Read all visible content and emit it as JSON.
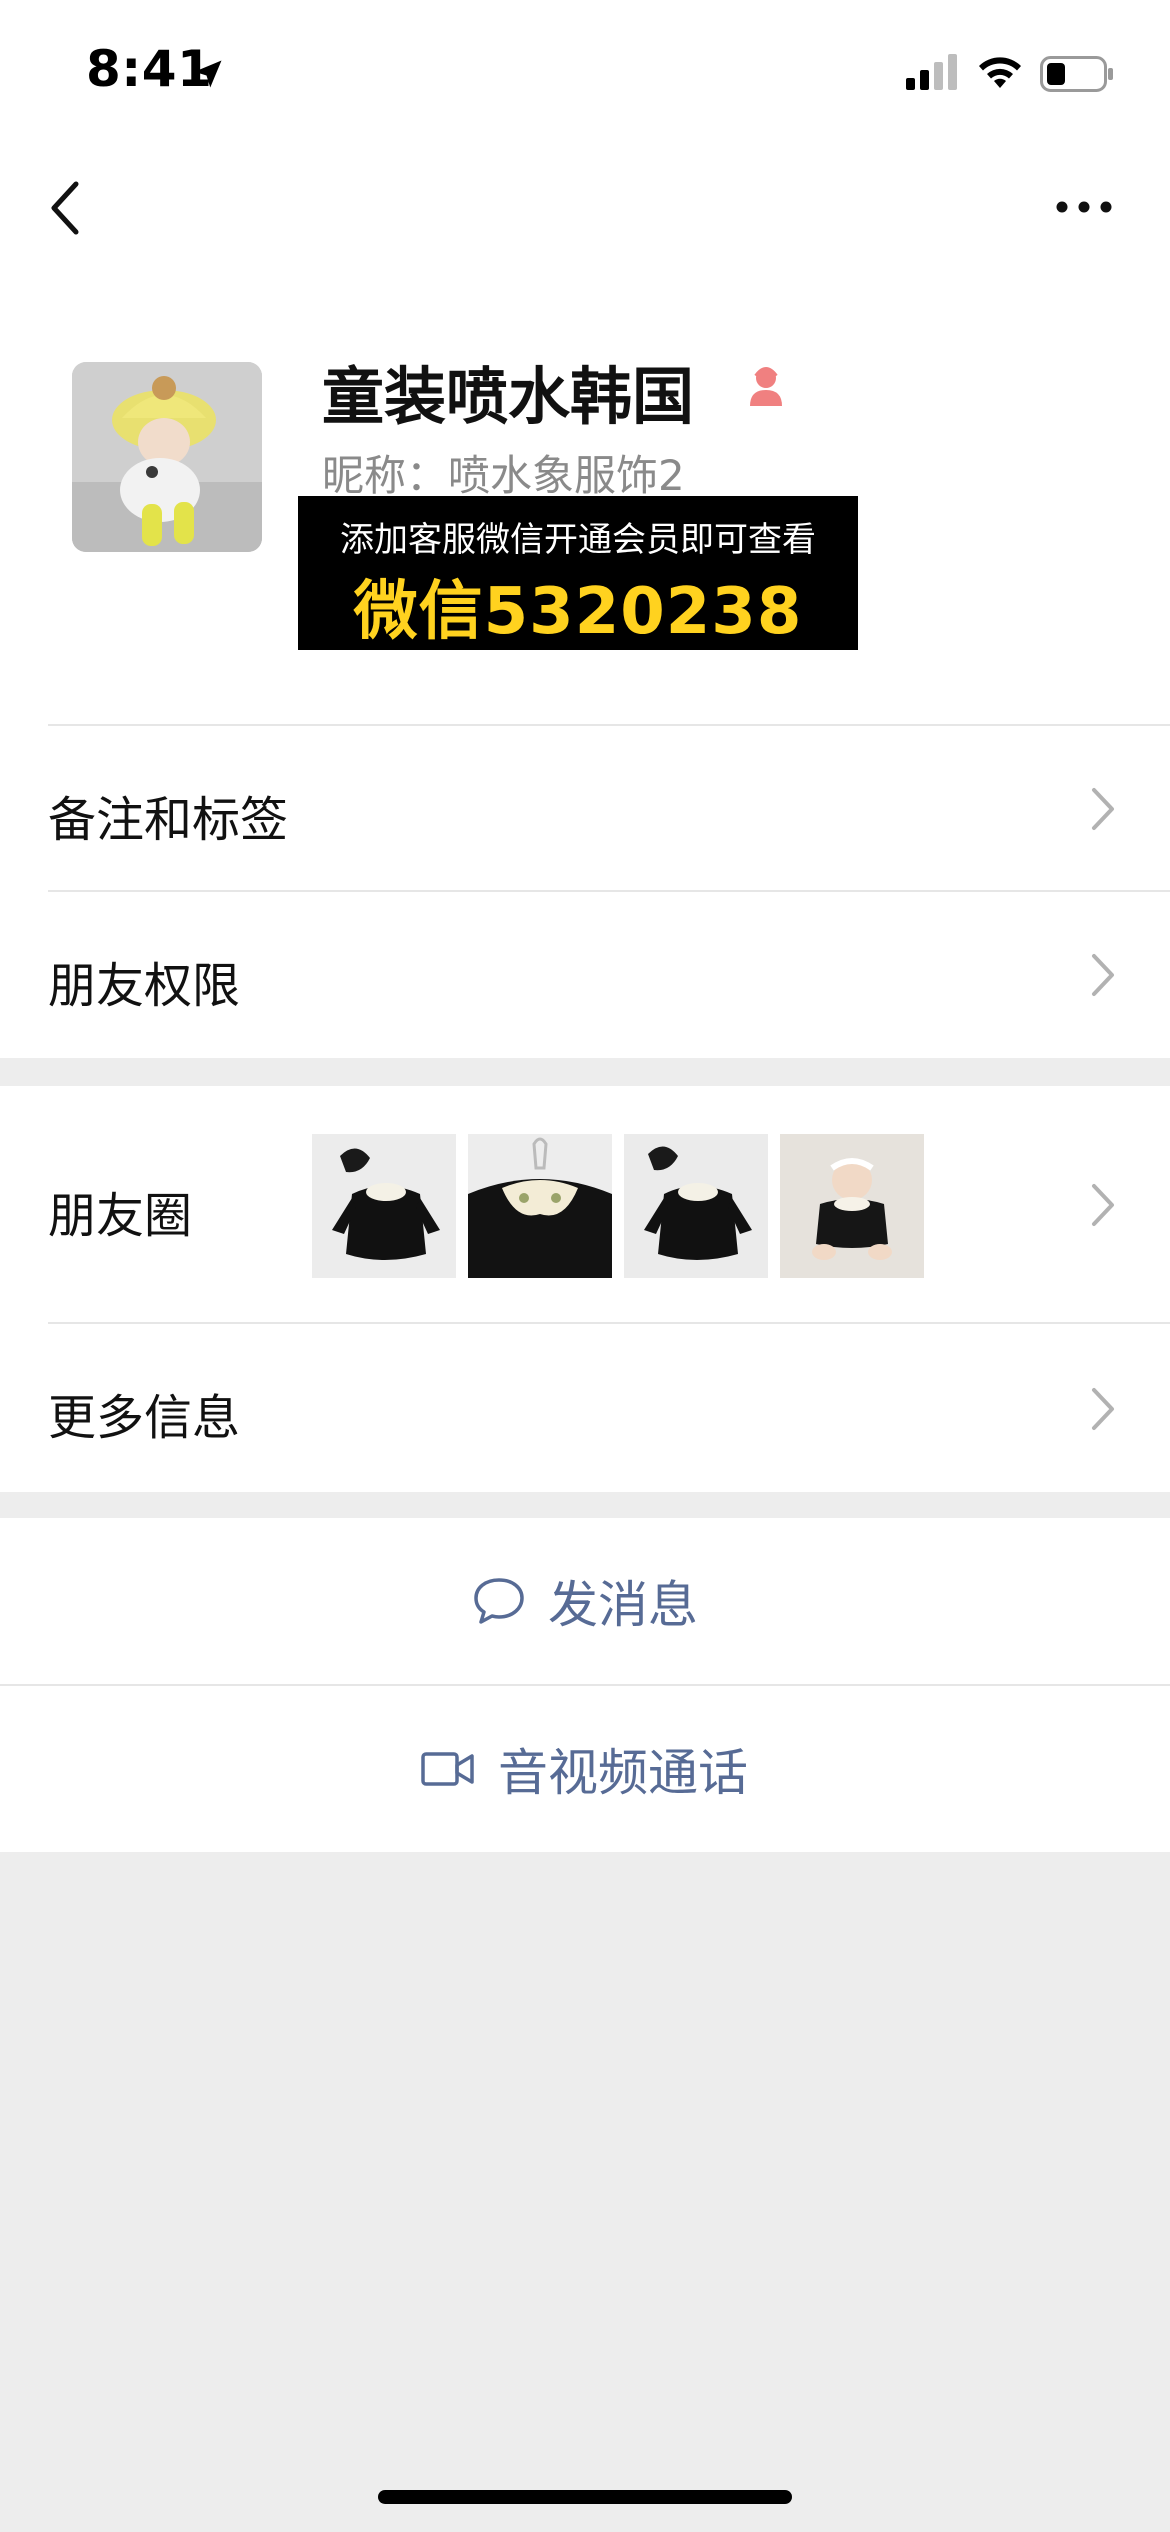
{
  "status_bar": {
    "time": "8:41"
  },
  "profile": {
    "name": "童装喷水韩国",
    "nickname": "昵称：喷水象服饰2",
    "gender_icon": "female-icon",
    "promo": {
      "line1": "添加客服微信开通会员即可查看",
      "line2": "微信5320238"
    }
  },
  "rows": {
    "remarks_tags": "备注和标签",
    "friend_permissions": "朋友权限",
    "moments": "朋友圈",
    "more_info": "更多信息"
  },
  "actions": {
    "send_message": "发消息",
    "video_call": "音视频通话"
  },
  "colors": {
    "link_blue": "#576b95",
    "promo_yellow": "#ffd21f",
    "page_gray": "#ededed",
    "female_pink": "#f08080"
  }
}
